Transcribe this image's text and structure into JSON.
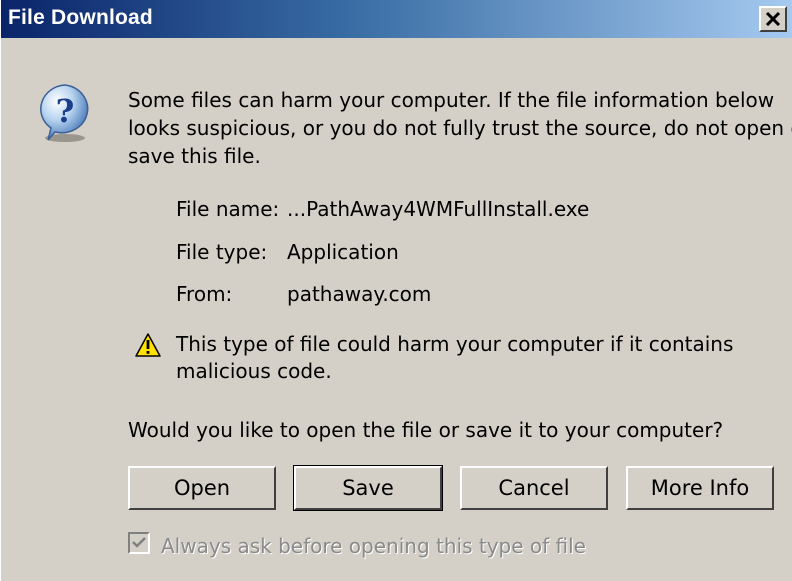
{
  "window": {
    "title": "File Download",
    "close_glyph": "×"
  },
  "message": {
    "line1": "Some files can harm your computer. If the file information below",
    "line2": "looks suspicious, or you do not fully trust the source, do not open or",
    "line3": "save this file."
  },
  "file_info": {
    "name_label": "File name:",
    "name_value": "...PathAway4WMFullInstall.exe",
    "type_label": "File type:",
    "type_value": "Application",
    "from_label": "From:",
    "from_value": "pathaway.com"
  },
  "warning": {
    "line1": "This type of file could harm your computer if it contains",
    "line2": "malicious code."
  },
  "question": "Would you like to open the file or save it to your computer?",
  "buttons": {
    "open": "Open",
    "save": "Save",
    "cancel": "Cancel",
    "more_info": "More Info"
  },
  "checkbox": {
    "label": "Always ask before opening this type of file",
    "checked": true,
    "enabled": false
  },
  "icons": {
    "question": "question-icon",
    "warning": "warning-icon",
    "close": "close-icon"
  },
  "colors": {
    "titlebar_start": "#0a246a",
    "titlebar_end": "#a6caf0",
    "face": "#d4d0c8"
  }
}
